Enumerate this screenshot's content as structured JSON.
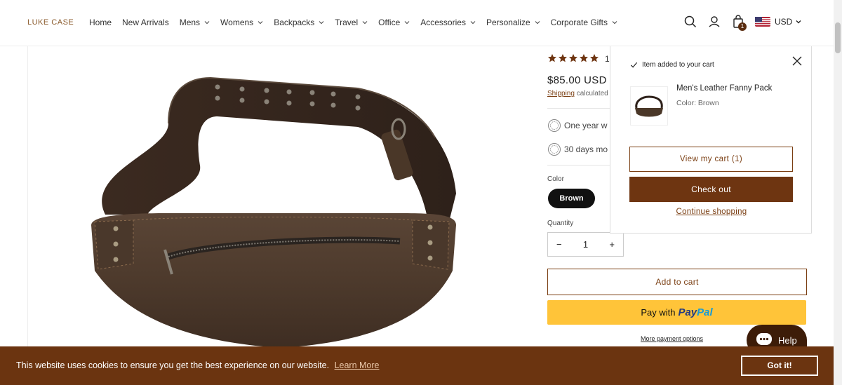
{
  "brand": {
    "logo": "LUKE CASE"
  },
  "nav": [
    {
      "label": "Home",
      "dropdown": false
    },
    {
      "label": "New Arrivals",
      "dropdown": false
    },
    {
      "label": "Mens",
      "dropdown": true
    },
    {
      "label": "Womens",
      "dropdown": true
    },
    {
      "label": "Backpacks",
      "dropdown": true
    },
    {
      "label": "Travel",
      "dropdown": true
    },
    {
      "label": "Office",
      "dropdown": true
    },
    {
      "label": "Accessories",
      "dropdown": true
    },
    {
      "label": "Personalize",
      "dropdown": true
    },
    {
      "label": "Corporate Gifts",
      "dropdown": true
    }
  ],
  "header_icons": {
    "search": "search-icon",
    "account": "account-icon",
    "cart": "cart-bag-icon",
    "cart_count": "1",
    "currency": "USD",
    "flag": "us-flag-icon"
  },
  "product": {
    "rating": 5,
    "rating_count_partial": "1",
    "price": "$85.00 USD",
    "shipping_link": "Shipping",
    "shipping_text": "calculated",
    "features": [
      "One year w",
      "30 days mo"
    ],
    "color_label": "Color",
    "color_value": "Brown",
    "quantity_label": "Quantity",
    "quantity": "1",
    "qty_minus": "−",
    "qty_plus": "+",
    "add_to_cart": "Add to cart",
    "paypal_prefix": "Pay with",
    "paypal_brand_1": "Pay",
    "paypal_brand_2": "Pal",
    "more_payment": "More payment options"
  },
  "cart_popup": {
    "added_text": "Item added to your cart",
    "item_name": "Men's Leather Fanny Pack",
    "item_color": "Color: Brown",
    "view_cart": "View my cart (1)",
    "checkout": "Check out",
    "continue": "Continue shopping"
  },
  "help": {
    "label": "Help"
  },
  "cookie": {
    "text": "This website uses cookies to ensure you get the best experience on our website.",
    "link": "Learn More",
    "button": "Got it!"
  },
  "colors": {
    "accent": "#7a3e12",
    "checkout": "#6e3511",
    "cookie_bg": "#6b3410",
    "paypal": "#ffc439"
  }
}
